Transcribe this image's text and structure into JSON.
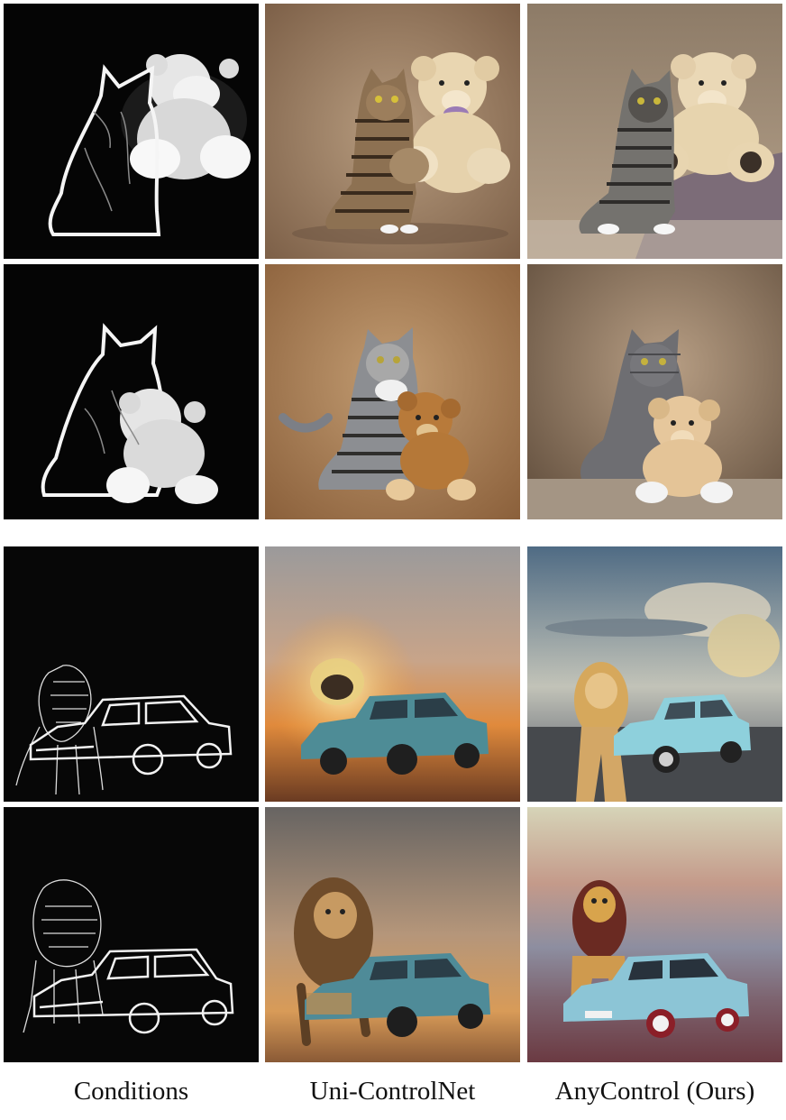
{
  "figure": {
    "columns": [
      {
        "label": "Conditions"
      },
      {
        "label": "Uni-ControlNet"
      },
      {
        "label": "AnyControl (Ours)"
      }
    ],
    "rows": [
      {
        "condition": {
          "kind": "edge+depth",
          "content": "cat edge map with teddy bear depth map"
        },
        "uni": {
          "content": "tabby cat beside cream teddy bear"
        },
        "ours": {
          "content": "tabby cat hugging cream teddy bear on couch"
        }
      },
      {
        "condition": {
          "kind": "edge+depth",
          "content": "cat edge map with teddy bear depth map in front"
        },
        "uni": {
          "content": "tabby cat with brown teddy bear"
        },
        "ours": {
          "content": "grey cat with light-brown teddy bear"
        }
      },
      {
        "condition": {
          "kind": "edge",
          "content": "lion and car edge map"
        },
        "uni": {
          "content": "blurred lion behind teal car at sunset"
        },
        "ours": {
          "content": "lion standing beside light-blue car under sky"
        }
      },
      {
        "condition": {
          "kind": "edge",
          "content": "larger lion and car edge map"
        },
        "uni": {
          "content": "lion blending into teal car"
        },
        "ours": {
          "content": "lion beside light-blue car, pastel sky"
        }
      }
    ]
  }
}
